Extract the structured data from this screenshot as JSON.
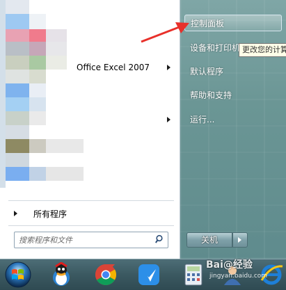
{
  "start_menu": {
    "left_pane": {
      "programs": [
        {
          "label": "Office Excel 2007",
          "has_submenu": true
        },
        {
          "label": "",
          "has_submenu": true
        }
      ],
      "all_programs_label": "所有程序",
      "search": {
        "placeholder": "搜索程序和文件",
        "icon": "search-icon"
      }
    },
    "right_pane": {
      "items": [
        {
          "label": "控制面板",
          "selected": true
        },
        {
          "label": "设备和打印机",
          "selected": false
        },
        {
          "label": "默认程序",
          "selected": false
        },
        {
          "label": "帮助和支持",
          "selected": false
        },
        {
          "label": "运行...",
          "selected": false
        }
      ],
      "shutdown_label": "关机"
    },
    "tooltip": "更改您的计算"
  },
  "taskbar": {
    "icons": [
      "start-orb-icon",
      "qq-icon",
      "chrome-icon",
      "feiyu-icon",
      "calculator-icon",
      "user-icon",
      "ie-icon"
    ]
  },
  "watermark": {
    "text": "Bai@经验",
    "sub": "jingyan.baidu.com"
  },
  "colors": {
    "annotation_arrow": "#e8302a",
    "right_pane_bg": "#6b9695",
    "taskbar_bg": "#3b5961"
  }
}
